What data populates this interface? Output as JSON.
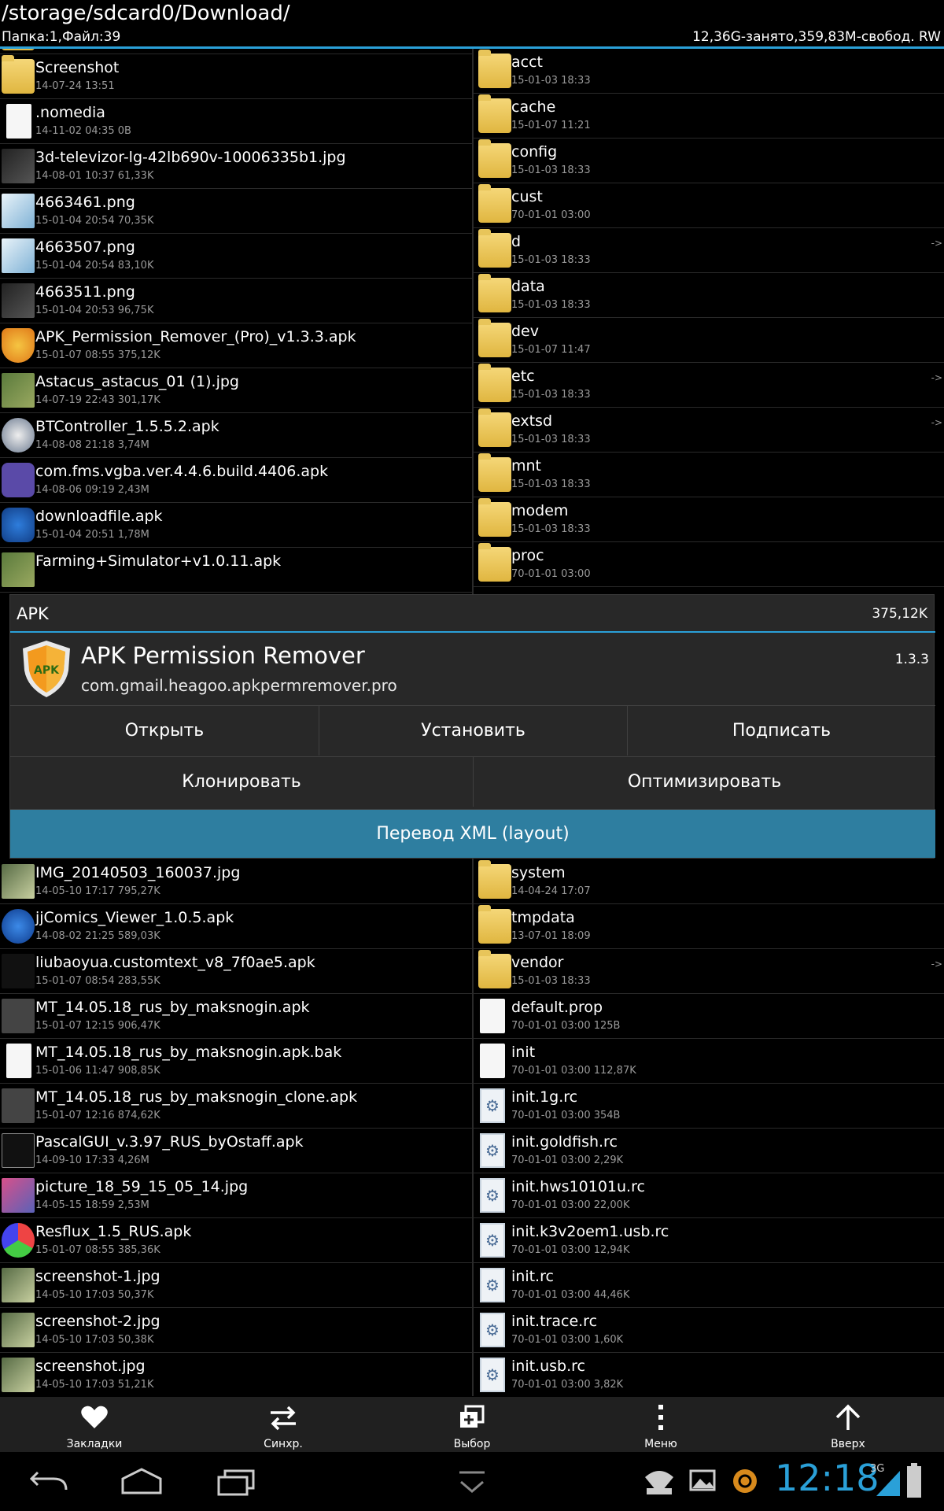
{
  "header": {
    "path": "/storage/sdcard0/Download/",
    "counts": "Папка:1,Файл:39",
    "storage": "12,36G-занято,359,83M-свобод. RW"
  },
  "left_files": [
    {
      "name": "Screenshot",
      "meta": "14-07-24 13:51",
      "icon": "folder"
    },
    {
      "name": ".nomedia",
      "meta": "14-11-02 04:35  0B",
      "icon": "file"
    },
    {
      "name": "3d-televizor-lg-42lb690v-10006335b1.jpg",
      "meta": "14-08-01 10:37  61,33K",
      "icon": "dark"
    },
    {
      "name": "4663461.png",
      "meta": "15-01-04 20:54  70,35K",
      "icon": "img"
    },
    {
      "name": "4663507.png",
      "meta": "15-01-04 20:54  83,10K",
      "icon": "img"
    },
    {
      "name": "4663511.png",
      "meta": "15-01-04 20:53  96,75K",
      "icon": "dark"
    },
    {
      "name": "APK_Permission_Remover_(Pro)_v1.3.3.apk",
      "meta": "15-01-07 08:55  375,12K",
      "icon": "apk"
    },
    {
      "name": "Astacus_astacus_01 (1).jpg",
      "meta": "14-07-19 22:43  301,17K",
      "icon": "grn"
    },
    {
      "name": "BTController_1.5.5.2.apk",
      "meta": "14-08-08 21:18  3,74M",
      "icon": "bt"
    },
    {
      "name": "com.fms.vgba.ver.4.4.6.build.4406.apk",
      "meta": "14-08-06 09:19  2,43M",
      "icon": "gba"
    },
    {
      "name": "downloadfile.apk",
      "meta": "15-01-04 20:51  1,78M",
      "icon": "shield"
    },
    {
      "name": "Farming+Simulator+v1.0.11.apk",
      "meta": "",
      "icon": "grn"
    },
    {
      "name": "IMG_20140503_160037.jpg",
      "meta": "14-05-10 17:17  795,27K",
      "icon": "cam"
    },
    {
      "name": "jjComics_Viewer_1.0.5.apk",
      "meta": "14-08-02 21:25  589,03K",
      "icon": "blue"
    },
    {
      "name": "liubaoyua.customtext_v8_7f0ae5.apk",
      "meta": "15-01-07 08:54  283,55K",
      "icon": "ct"
    },
    {
      "name": "MT_14.05.18_rus_by_maksnogin.apk",
      "meta": "15-01-07 12:15  906,47K",
      "icon": "mt"
    },
    {
      "name": "MT_14.05.18_rus_by_maksnogin.apk.bak",
      "meta": "15-01-06 11:47  908,85K",
      "icon": "file"
    },
    {
      "name": "MT_14.05.18_rus_by_maksnogin_clone.apk",
      "meta": "15-01-07 12:16  874,62K",
      "icon": "mt"
    },
    {
      "name": "PascalGUI_v.3.97_RUS_byOstaff.apk",
      "meta": "14-09-10 17:33  4,26M",
      "icon": "pg"
    },
    {
      "name": "picture_18_59_15_05_14.jpg",
      "meta": "14-05-15 18:59  2,53M",
      "icon": "pink"
    },
    {
      "name": "Resflux_1.5_RUS.apk",
      "meta": "15-01-07 08:55  385,36K",
      "icon": "res"
    },
    {
      "name": "screenshot-1.jpg",
      "meta": "14-05-10 17:03  50,37K",
      "icon": "cam"
    },
    {
      "name": "screenshot-2.jpg",
      "meta": "14-05-10 17:03  50,38K",
      "icon": "cam"
    },
    {
      "name": "screenshot.jpg",
      "meta": "14-05-10 17:03  51,21K",
      "icon": "cam"
    }
  ],
  "right_files": [
    {
      "name": "acct",
      "meta": "15-01-03 18:33",
      "icon": "folder",
      "arrow": ""
    },
    {
      "name": "cache",
      "meta": "15-01-07 11:21",
      "icon": "folder",
      "arrow": ""
    },
    {
      "name": "config",
      "meta": "15-01-03 18:33",
      "icon": "folder",
      "arrow": ""
    },
    {
      "name": "cust",
      "meta": "70-01-01 03:00",
      "icon": "folder",
      "arrow": ""
    },
    {
      "name": "d",
      "meta": "15-01-03 18:33",
      "icon": "folder",
      "arrow": "->"
    },
    {
      "name": "data",
      "meta": "15-01-03 18:33",
      "icon": "folder",
      "arrow": ""
    },
    {
      "name": "dev",
      "meta": "15-01-07 11:47",
      "icon": "folder",
      "arrow": ""
    },
    {
      "name": "etc",
      "meta": "15-01-03 18:33",
      "icon": "folder",
      "arrow": "->"
    },
    {
      "name": "extsd",
      "meta": "15-01-03 18:33",
      "icon": "folder",
      "arrow": "->"
    },
    {
      "name": "mnt",
      "meta": "15-01-03 18:33",
      "icon": "folder",
      "arrow": ""
    },
    {
      "name": "modem",
      "meta": "15-01-03 18:33",
      "icon": "folder",
      "arrow": ""
    },
    {
      "name": "proc",
      "meta": "70-01-01 03:00",
      "icon": "folder",
      "arrow": ""
    },
    {
      "name": "system",
      "meta": "14-04-24 17:07",
      "icon": "folder",
      "arrow": ""
    },
    {
      "name": "tmpdata",
      "meta": "13-07-01 18:09",
      "icon": "folder",
      "arrow": ""
    },
    {
      "name": "vendor",
      "meta": "15-01-03 18:33",
      "icon": "folder",
      "arrow": "->"
    },
    {
      "name": "default.prop",
      "meta": "70-01-01 03:00  125B",
      "icon": "file",
      "arrow": ""
    },
    {
      "name": "init",
      "meta": "70-01-01 03:00  112,87K",
      "icon": "file",
      "arrow": ""
    },
    {
      "name": "init.1g.rc",
      "meta": "70-01-01 03:00  354B",
      "icon": "rc",
      "arrow": ""
    },
    {
      "name": "init.goldfish.rc",
      "meta": "70-01-01 03:00  2,29K",
      "icon": "rc",
      "arrow": ""
    },
    {
      "name": "init.hws10101u.rc",
      "meta": "70-01-01 03:00  22,00K",
      "icon": "rc",
      "arrow": ""
    },
    {
      "name": "init.k3v2oem1.usb.rc",
      "meta": "70-01-01 03:00  12,94K",
      "icon": "rc",
      "arrow": ""
    },
    {
      "name": "init.rc",
      "meta": "70-01-01 03:00  44,46K",
      "icon": "rc",
      "arrow": ""
    },
    {
      "name": "init.trace.rc",
      "meta": "70-01-01 03:00  1,60K",
      "icon": "rc",
      "arrow": ""
    },
    {
      "name": "init.usb.rc",
      "meta": "70-01-01 03:00  3,82K",
      "icon": "rc",
      "arrow": ""
    }
  ],
  "dialog": {
    "title": "APK",
    "size": "375,12K",
    "app_name": "APK Permission Remover",
    "package": "com.gmail.heagoo.apkpermremover.pro",
    "version": "1.3.3",
    "icon_text": "APK",
    "buttons": {
      "open": "Открыть",
      "install": "Установить",
      "sign": "Подписать",
      "clone": "Клонировать",
      "optimize": "Оптимизировать",
      "translate_xml": "Перевод XML (layout)"
    }
  },
  "bottom_bar": {
    "bookmarks": "Закладки",
    "sync": "Синхр.",
    "select": "Выбор",
    "menu": "Меню",
    "up": "Вверх"
  },
  "status": {
    "clock": "12:18",
    "network": "3G"
  },
  "colors": {
    "accent": "#2aa0d8",
    "dialog_bg": "#282828",
    "xml_button": "#2e7ea0"
  }
}
